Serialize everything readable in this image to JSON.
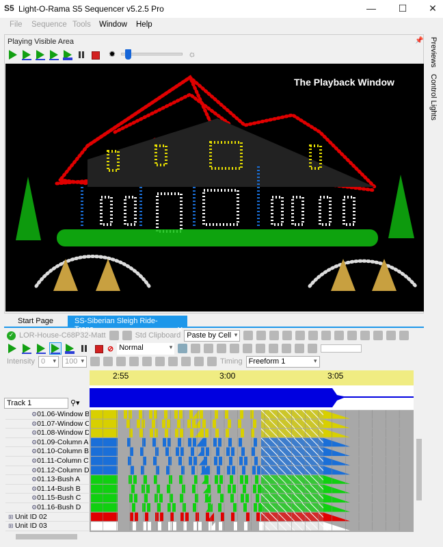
{
  "window": {
    "logo": "S5",
    "title": "Light-O-Rama S5 Sequencer v5.2.5 Pro",
    "minimize": "—",
    "maximize": "☐",
    "close": "✕"
  },
  "menu": [
    {
      "label": "File",
      "enabled": false
    },
    {
      "label": "Sequence",
      "enabled": false
    },
    {
      "label": "Tools",
      "enabled": false
    },
    {
      "label": "Window",
      "enabled": true
    },
    {
      "label": "Help",
      "enabled": true
    }
  ],
  "playback": {
    "label": "Playing Visible Area",
    "brightness": 0.12,
    "overlay_title": "The Playback Window"
  },
  "side_tabs": [
    "Previews",
    "Control Lights"
  ],
  "tabs": [
    {
      "label": "Start Page"
    },
    {
      "label": "SS-Siberian Sleigh Ride-Trans...",
      "active": true,
      "close": "✕"
    }
  ],
  "toolbar1": {
    "sequence": "LOR-House-C68P32-Matt",
    "clipboard": "Std Clipboard",
    "paste_mode": "Paste by Cell"
  },
  "toolbar2": {
    "play_mode": "Normal"
  },
  "toolbar3": {
    "intensity_label": "Intensity",
    "intensity_min": "0",
    "intensity_max": "100",
    "timing_label": "Timing",
    "timing_value": "Freeform 1"
  },
  "timeline": {
    "ticks": [
      "2:55",
      "3:00",
      "3:05"
    ],
    "track": "Track 1"
  },
  "rows": [
    {
      "label": "01.06-Window B",
      "color": "#d8d000"
    },
    {
      "label": "01.07-Window C",
      "color": "#d8d000"
    },
    {
      "label": "01.08-Window D",
      "color": "#d8d000"
    },
    {
      "label": "01.09-Column A",
      "color": "#1a6fd8"
    },
    {
      "label": "01.10-Column B",
      "color": "#1a6fd8"
    },
    {
      "label": "01.11-Column C",
      "color": "#1a6fd8"
    },
    {
      "label": "01.12-Column D",
      "color": "#1a6fd8"
    },
    {
      "label": "01.13-Bush A",
      "color": "#10d010"
    },
    {
      "label": "01.14-Bush B",
      "color": "#10d010"
    },
    {
      "label": "01.15-Bush C",
      "color": "#10d010"
    },
    {
      "label": "01.16-Bush D",
      "color": "#10d010"
    },
    {
      "label": "Unit ID 02",
      "color": "#e00000",
      "group": true
    },
    {
      "label": "Unit ID 03",
      "color": "#ffffff",
      "group": true
    }
  ],
  "colors": {
    "accent": "#1c97ea",
    "waveform": "#0000e0",
    "ruler": "#f0ec82"
  }
}
